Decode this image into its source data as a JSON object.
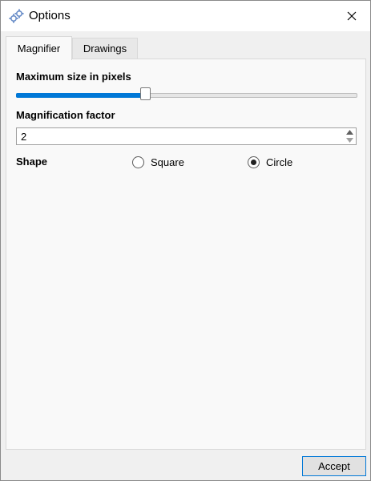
{
  "window": {
    "title": "Options",
    "app_icon": "gears-icon",
    "close_icon": "close-icon"
  },
  "tabs": [
    {
      "label": "Magnifier",
      "active": true
    },
    {
      "label": "Drawings",
      "active": false
    }
  ],
  "magnifier": {
    "max_size_label": "Maximum size in pixels",
    "max_size_slider_fraction": 0.38,
    "factor_label": "Magnification factor",
    "factor_value": "2",
    "shape_label": "Shape",
    "shape_options": [
      {
        "label": "Square",
        "checked": false
      },
      {
        "label": "Circle",
        "checked": true
      }
    ]
  },
  "footer": {
    "accept_label": "Accept"
  },
  "colors": {
    "accent": "#0078d7"
  }
}
